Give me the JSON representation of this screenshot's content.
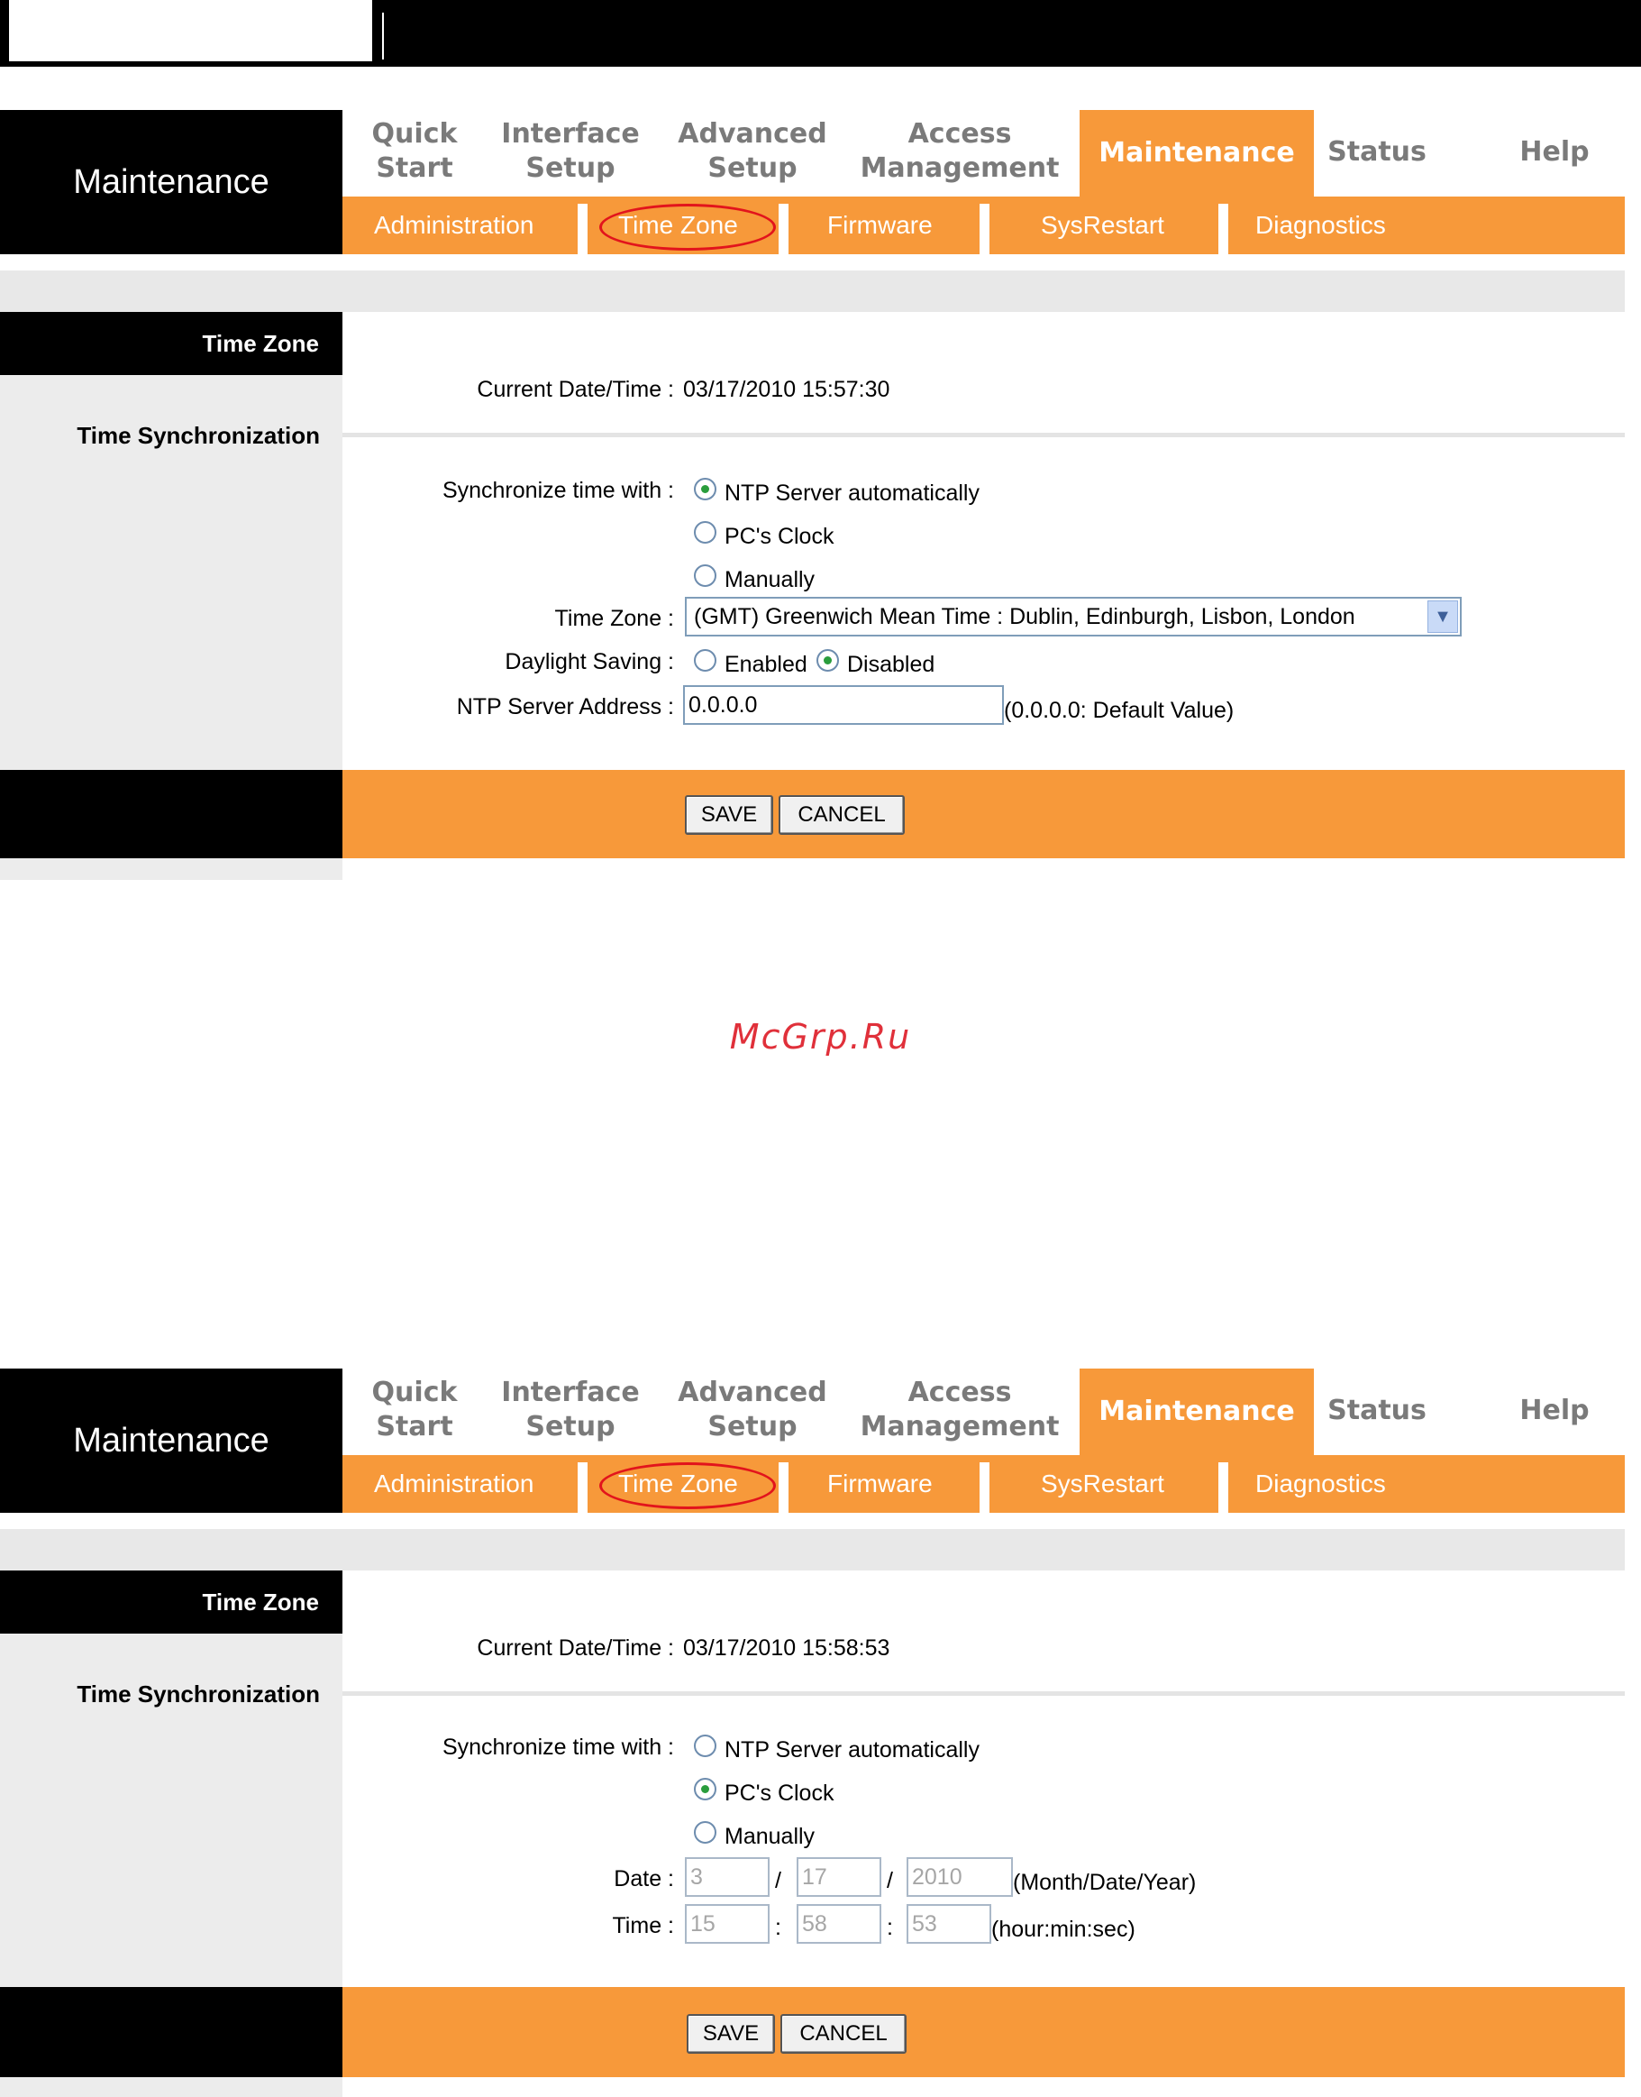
{
  "nav": {
    "title": "Maintenance",
    "tabs": [
      {
        "label": "Quick\nStart"
      },
      {
        "label": "Interface\nSetup"
      },
      {
        "label": "Advanced\nSetup"
      },
      {
        "label": "Access\nManagement"
      },
      {
        "label": "Maintenance"
      },
      {
        "label": "Status"
      },
      {
        "label": "Help"
      }
    ],
    "subtabs": [
      {
        "label": "Administration"
      },
      {
        "label": "Time Zone"
      },
      {
        "label": "Firmware"
      },
      {
        "label": "SysRestart"
      },
      {
        "label": "Diagnostics"
      }
    ]
  },
  "section": {
    "title": "Time Zone",
    "subtitle": "Time Synchronization"
  },
  "labels": {
    "current": "Current Date/Time :",
    "sync": "Synchronize time with :",
    "timezone": "Time Zone :",
    "daylight": "Daylight Saving :",
    "ntp": "NTP Server Address :",
    "date": "Date :",
    "time": "Time :"
  },
  "options": {
    "ntp": "NTP Server automatically",
    "pc": "PC's Clock",
    "manual": "Manually",
    "enabled": "Enabled",
    "disabled": "Disabled"
  },
  "panel1": {
    "current_datetime": "03/17/2010 15:57:30",
    "timezone_value": "(GMT) Greenwich Mean Time : Dublin, Edinburgh, Lisbon, London",
    "ntp_address": "0.0.0.0",
    "ntp_hint": "(0.0.0.0: Default Value)",
    "sync_selected": "ntp",
    "daylight_selected": "disabled"
  },
  "panel2": {
    "current_datetime": "03/17/2010 15:58:53",
    "sync_selected": "pc",
    "date": {
      "month": "3",
      "day": "17",
      "year": "2010",
      "sep": "/",
      "hint": "(Month/Date/Year)"
    },
    "time": {
      "hour": "15",
      "min": "58",
      "sec": "53",
      "sep": ":",
      "hint": "(hour:min:sec)"
    }
  },
  "buttons": {
    "save": "SAVE",
    "cancel": "CANCEL"
  },
  "watermark": "McGrp.Ru",
  "colors": {
    "accent": "#f7993a",
    "highlight_circle": "#e2141c",
    "tab_inactive": "#7a7a7a"
  }
}
